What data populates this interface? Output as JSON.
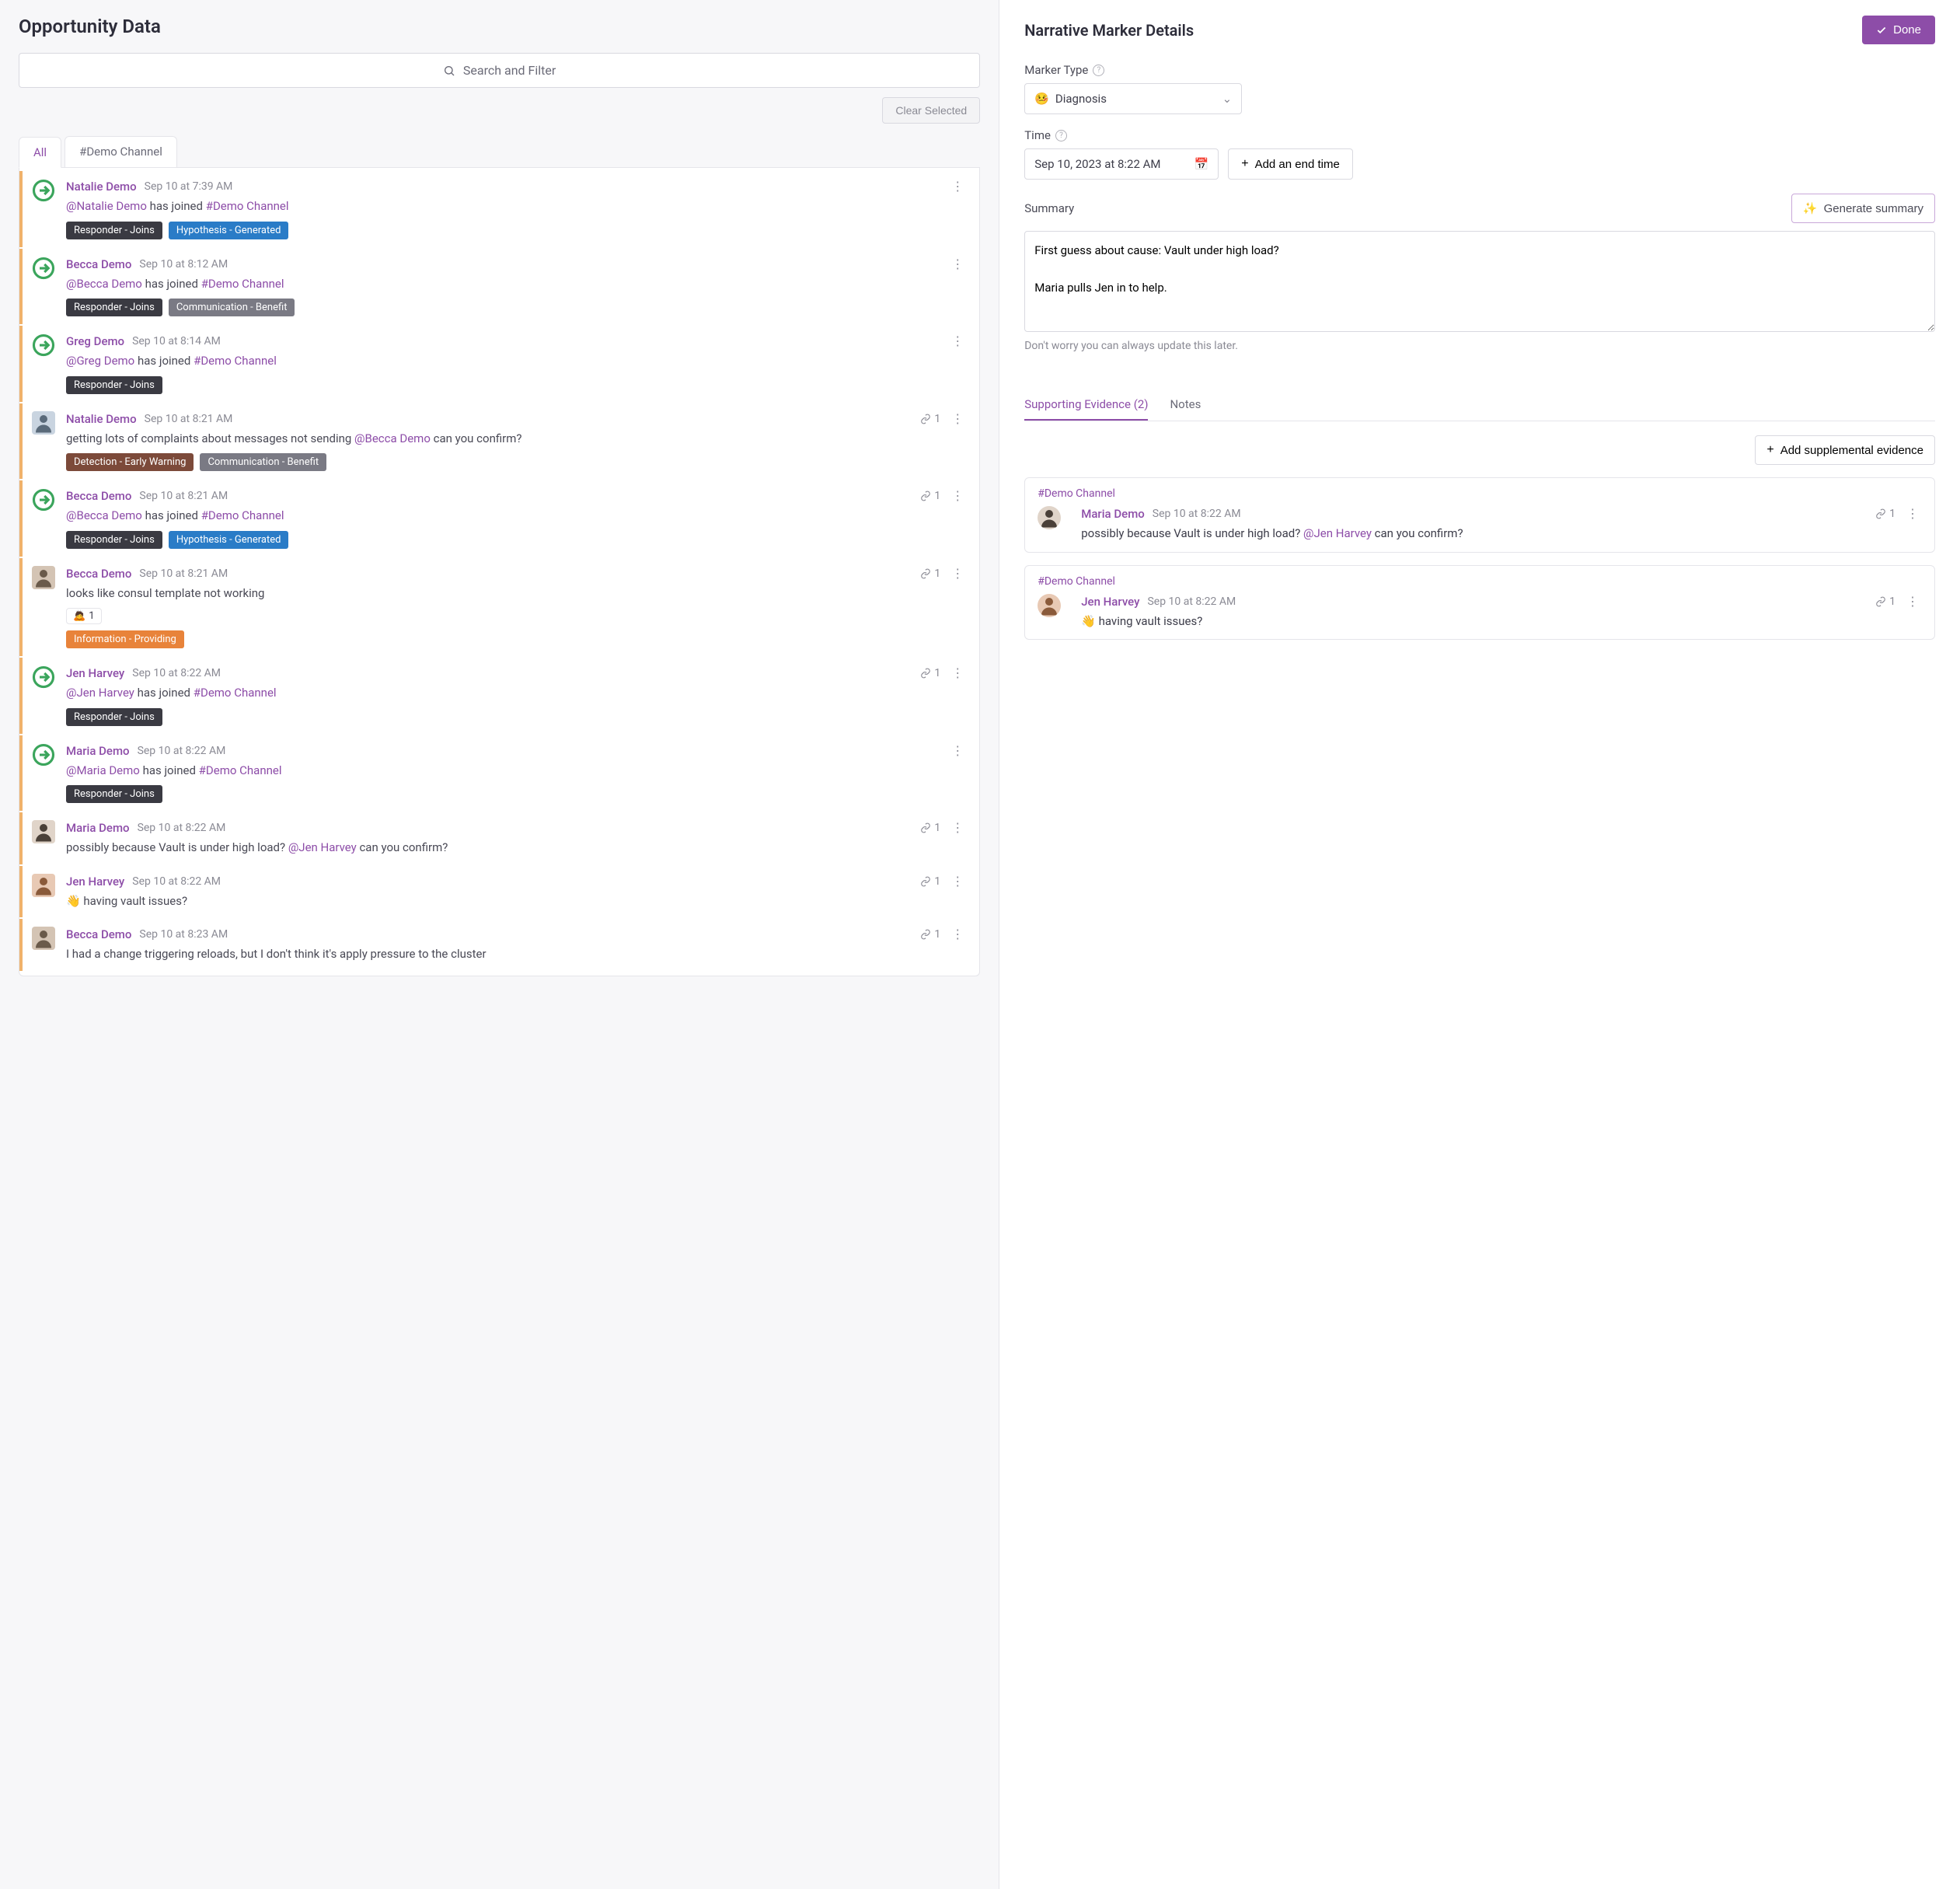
{
  "left": {
    "title": "Opportunity Data",
    "searchPlaceholder": "Search and Filter",
    "clearSelected": "Clear Selected",
    "tabs": [
      "All",
      "#Demo Channel"
    ],
    "activeTab": 0
  },
  "messages": [
    {
      "id": 0,
      "avatar": "join",
      "name": "Natalie Demo",
      "time": "Sep 10 at 7:39 AM",
      "joinUser": "@Natalie Demo",
      "joinText": " has joined ",
      "joinChannel": "#Demo Channel",
      "tags": [
        {
          "label": "Responder - Joins",
          "cls": "dk"
        },
        {
          "label": "Hypothesis - Generated",
          "cls": "blue"
        }
      ],
      "linkCount": null
    },
    {
      "id": 1,
      "avatar": "join",
      "name": "Becca Demo",
      "time": "Sep 10 at 8:12 AM",
      "joinUser": "@Becca Demo",
      "joinText": " has joined ",
      "joinChannel": "#Demo Channel",
      "tags": [
        {
          "label": "Responder - Joins",
          "cls": "dk"
        },
        {
          "label": "Communication - Benefit",
          "cls": "grey"
        }
      ],
      "linkCount": null
    },
    {
      "id": 2,
      "avatar": "join",
      "name": "Greg Demo",
      "time": "Sep 10 at 8:14 AM",
      "joinUser": "@Greg Demo",
      "joinText": " has joined ",
      "joinChannel": "#Demo Channel",
      "tags": [
        {
          "label": "Responder - Joins",
          "cls": "dk"
        }
      ],
      "linkCount": null
    },
    {
      "id": 3,
      "avatar": "photo1",
      "name": "Natalie Demo",
      "time": "Sep 10 at 8:21 AM",
      "pre": "getting lots of complaints about messages not sending ",
      "mention": "@Becca Demo",
      "post": " can you confirm?",
      "tags": [
        {
          "label": "Detection - Early Warning",
          "cls": "brown"
        },
        {
          "label": "Communication - Benefit",
          "cls": "grey"
        }
      ],
      "linkCount": "1"
    },
    {
      "id": 4,
      "avatar": "join",
      "name": "Becca Demo",
      "time": "Sep 10 at 8:21 AM",
      "joinUser": "@Becca Demo",
      "joinText": " has joined ",
      "joinChannel": "#Demo Channel",
      "tags": [
        {
          "label": "Responder - Joins",
          "cls": "dk"
        },
        {
          "label": "Hypothesis - Generated",
          "cls": "blue"
        }
      ],
      "linkCount": "1"
    },
    {
      "id": 5,
      "avatar": "photo2",
      "name": "Becca Demo",
      "time": "Sep 10 at 8:21 AM",
      "text": "looks like consul template not working",
      "react": {
        "emoji": "🙇",
        "count": "1"
      },
      "tags": [
        {
          "label": "Information - Providing",
          "cls": "orange"
        }
      ],
      "linkCount": "1"
    },
    {
      "id": 6,
      "avatar": "join",
      "name": "Jen Harvey",
      "time": "Sep 10 at 8:22 AM",
      "joinUser": "@Jen Harvey",
      "joinText": " has joined ",
      "joinChannel": "#Demo Channel",
      "tags": [
        {
          "label": "Responder - Joins",
          "cls": "dk"
        }
      ],
      "linkCount": "1"
    },
    {
      "id": 7,
      "avatar": "join",
      "name": "Maria Demo",
      "time": "Sep 10 at 8:22 AM",
      "joinUser": "@Maria Demo",
      "joinText": " has joined ",
      "joinChannel": "#Demo Channel",
      "tags": [
        {
          "label": "Responder - Joins",
          "cls": "dk"
        }
      ],
      "linkCount": null
    },
    {
      "id": 8,
      "avatar": "photo3",
      "name": "Maria Demo",
      "time": "Sep 10 at 8:22 AM",
      "pre": "possibly because Vault is under high load? ",
      "mention": "@Jen Harvey",
      "post": " can you confirm?",
      "tags": [],
      "linkCount": "1"
    },
    {
      "id": 9,
      "avatar": "photo4",
      "name": "Jen Harvey",
      "time": "Sep 10 at 8:22 AM",
      "text": "👋 having vault issues?",
      "tags": [],
      "linkCount": "1"
    },
    {
      "id": 10,
      "avatar": "photo2",
      "name": "Becca Demo",
      "time": "Sep 10 at 8:23 AM",
      "text": "I had a change triggering reloads, but I don't think it's apply pressure to the cluster",
      "tags": [],
      "linkCount": "1"
    }
  ],
  "right": {
    "title": "Narrative Marker Details",
    "done": "Done",
    "markerTypeLabel": "Marker Type",
    "markerTypeEmoji": "🤒",
    "markerTypeValue": "Diagnosis",
    "timeLabel": "Time",
    "timeValue": "Sep 10, 2023 at 8:22 AM",
    "addEndTime": "Add an end time",
    "summaryLabel": "Summary",
    "generateSummary": "Generate summary",
    "summaryText": "First guess about cause: Vault under high load?\n\nMaria pulls Jen in to help.",
    "summaryHint": "Don't worry you can always update this later.",
    "subTabs": [
      "Supporting Evidence (2)",
      "Notes"
    ],
    "activeSubTab": 0,
    "addEvidence": "Add supplemental evidence"
  },
  "evidence": [
    {
      "channel": "#Demo Channel",
      "avatar": "photo3",
      "name": "Maria Demo",
      "time": "Sep 10 at 8:22 AM",
      "pre": "possibly because Vault is under high load? ",
      "mention": "@Jen Harvey",
      "post": " can you confirm?",
      "linkCount": "1"
    },
    {
      "channel": "#Demo Channel",
      "avatar": "photo4",
      "name": "Jen Harvey",
      "time": "Sep 10 at 8:22 AM",
      "text": "👋 having vault issues?",
      "linkCount": "1"
    }
  ],
  "avatarColors": {
    "photo1": {
      "bg": "#c9d4e0",
      "fg": "#5a6a7a"
    },
    "photo2": {
      "bg": "#d4c4b4",
      "fg": "#6a5a4a"
    },
    "photo3": {
      "bg": "#e0d4c9",
      "fg": "#4a4038"
    },
    "photo4": {
      "bg": "#e8c9b4",
      "fg": "#8a5a3a"
    }
  }
}
